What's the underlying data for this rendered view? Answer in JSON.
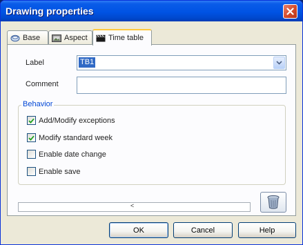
{
  "window": {
    "title": "Drawing properties"
  },
  "tabs": [
    {
      "label": "Base",
      "icon": "cylinder-icon"
    },
    {
      "label": "Aspect",
      "icon": "picture-icon"
    },
    {
      "label": "Time table",
      "icon": "clapperboard-icon"
    }
  ],
  "active_tab": "Time table",
  "form": {
    "label_caption": "Label",
    "label_value": "TB1",
    "comment_caption": "Comment",
    "comment_value": ""
  },
  "behavior": {
    "legend": "Behavior",
    "options": [
      {
        "label": "Add/Modify exceptions",
        "checked": true
      },
      {
        "label": "Modify standard week",
        "checked": true
      },
      {
        "label": "Enable date change",
        "checked": false
      },
      {
        "label": "Enable save",
        "checked": false
      }
    ]
  },
  "status_field": {
    "caret": "<"
  },
  "buttons": {
    "ok": "OK",
    "cancel": "Cancel",
    "help": "Help"
  },
  "colors": {
    "title_bar": "#0053e4",
    "close_button": "#d34a2a",
    "accent_legend": "#0046d5",
    "selection": "#316ac5",
    "active_tab_highlight": "#ffc83c",
    "dialog_bg": "#ece9d8"
  }
}
